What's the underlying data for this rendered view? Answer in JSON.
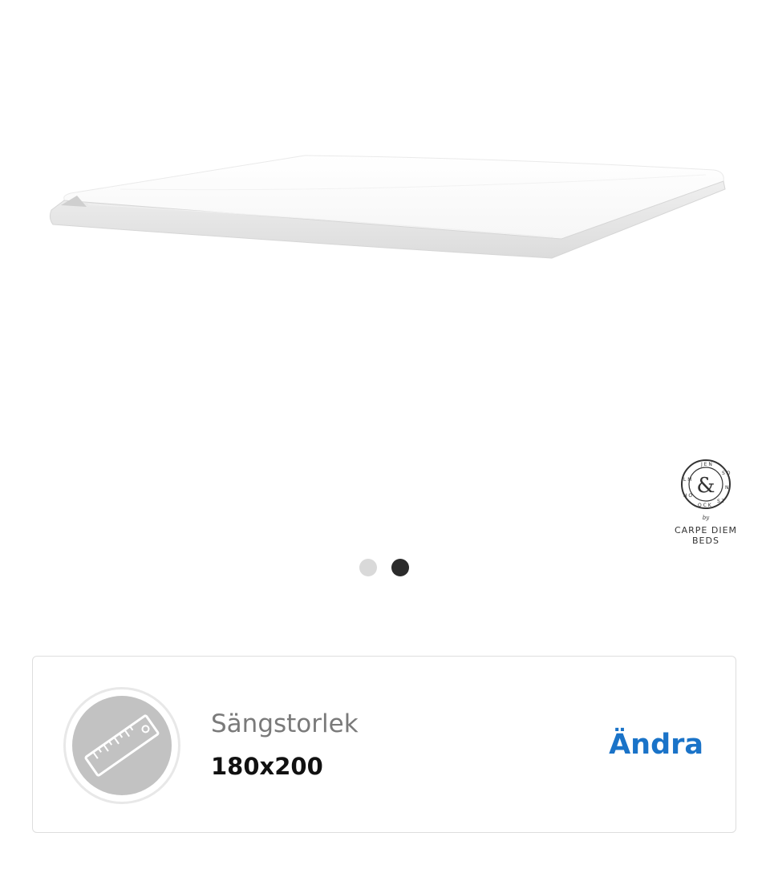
{
  "product": {
    "image_alt": "Bäddmadrass",
    "brand": {
      "by": "by",
      "line1": "CARPE DIEM",
      "line2": "BEDS",
      "seal_text": "JENSON & STOCKHOLM"
    }
  },
  "carousel": {
    "total_slides": 2,
    "active_slide": 2
  },
  "size_selector": {
    "label": "Sängstorlek",
    "value": "180x200",
    "change_label": "Ändra",
    "icon": "ruler-icon"
  },
  "colors": {
    "accent": "#1a73c8",
    "dot_active": "#2b2b2b",
    "dot_inactive": "#d9d9d9"
  }
}
